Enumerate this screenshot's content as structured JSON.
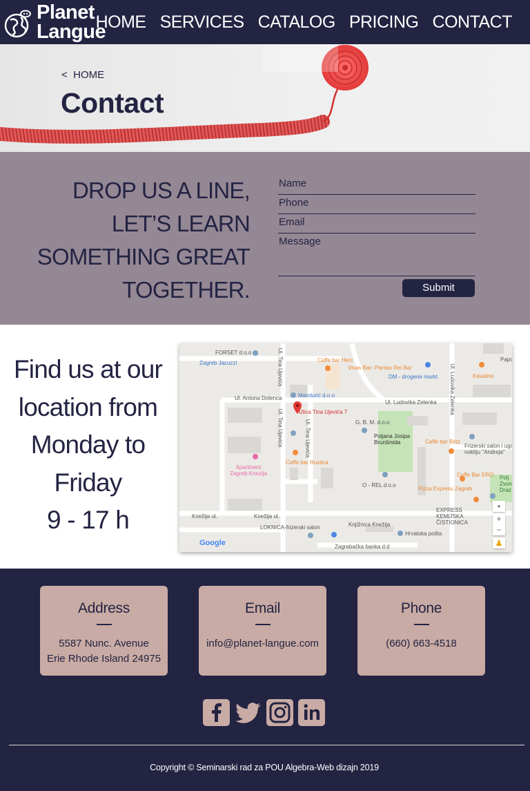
{
  "brand": {
    "name_line1": "Planet",
    "name_line2": "Langue"
  },
  "nav": {
    "items": [
      {
        "label": "HOME"
      },
      {
        "label": "SERVICES"
      },
      {
        "label": "CATALOG"
      },
      {
        "label": "PRICING"
      },
      {
        "label": "CONTACT"
      }
    ]
  },
  "hero": {
    "breadcrumb_arrow": "<",
    "breadcrumb": "HOME",
    "title": "Contact"
  },
  "drop": {
    "heading_lines": [
      "DROP US A LINE,",
      "LET’S LEARN",
      "SOMETHING GREAT",
      "TOGETHER."
    ],
    "form": {
      "name": "Name",
      "phone": "Phone",
      "email": "Email",
      "message": "Message",
      "submit": "Submit"
    }
  },
  "location": {
    "lines": [
      "Find us at our",
      "location from",
      "Monday to",
      "Friday",
      "9 - 17 h"
    ],
    "map": {
      "labels": {
        "forset": "FORSET d.o.o",
        "zagreb_jacuzzi": "Zagreb Jacuzzi",
        "caffe_herc": "Caffe bar Herc",
        "vivas": "Vivas Bar- Pantas Rei Bar",
        "dm": "DM - drogerie markt",
        "kavalino": "Kavalino",
        "papo": "Papo",
        "antona": "Ul. Antona Dolenca",
        "manduric": "Mandurić d.o.o",
        "ludovika": "Ul. Ludovika Zelenka",
        "ludovika_v": "Ul. Ludovika Zelenka",
        "tina": "Ulica Tina Ujevića 7",
        "tina_v1": "Ul. Tina Ujevića",
        "tina_v2": "Ul. Tina Ujevića",
        "tina_v3": "Ul. Tina Ujevića",
        "gbm": "G. B. M. d.o.o",
        "poljana": "Poljana Josipa Brunšmida",
        "birtz": "Caffe bar Birtz",
        "frizerski": "Frizerski salon i ugo noktiju \"Andreja\"",
        "rustica": "Caffe bar Rustica",
        "apartment": "Apartment Zagreb Knezija",
        "ero": "Caffe Bar ERO",
        "polj": "Polj Zvon Draz",
        "orel": "O - REL d.o.o",
        "pizza": "Pizza Express Zagreb",
        "cistionica": "EXPRESS KEMIJSKA ČISTIONICA",
        "knezija1": "Knežija ul.",
        "knezija2": "Knežija ul.",
        "loknica": "LOKNICA-frizerski salon",
        "knjiznica": "Knjižnica Knežija",
        "posta": "Hrvatska pošta",
        "banka": "Zagrebačka banka d.d",
        "google": "Google",
        "zoom_in": "+",
        "zoom_out": "−"
      }
    }
  },
  "footer": {
    "cards": [
      {
        "title": "Address",
        "lines": [
          "5587 Nunc. Avenue",
          "Erie Rhode Island 24975"
        ]
      },
      {
        "title": "Email",
        "lines": [
          "info@planet-langue.com"
        ]
      },
      {
        "title": "Phone",
        "lines": [
          "(660) 663-4518"
        ]
      }
    ],
    "social": [
      "facebook-icon",
      "twitter-icon",
      "instagram-icon",
      "linkedin-icon"
    ],
    "copyright": "Copyright © Seminarski rad za POU Algebra-Web dizajn 2019"
  },
  "colors": {
    "navy": "#232342",
    "mauve": "#958895",
    "rose": "#c8aba4",
    "accent": "#ea3f3f"
  }
}
